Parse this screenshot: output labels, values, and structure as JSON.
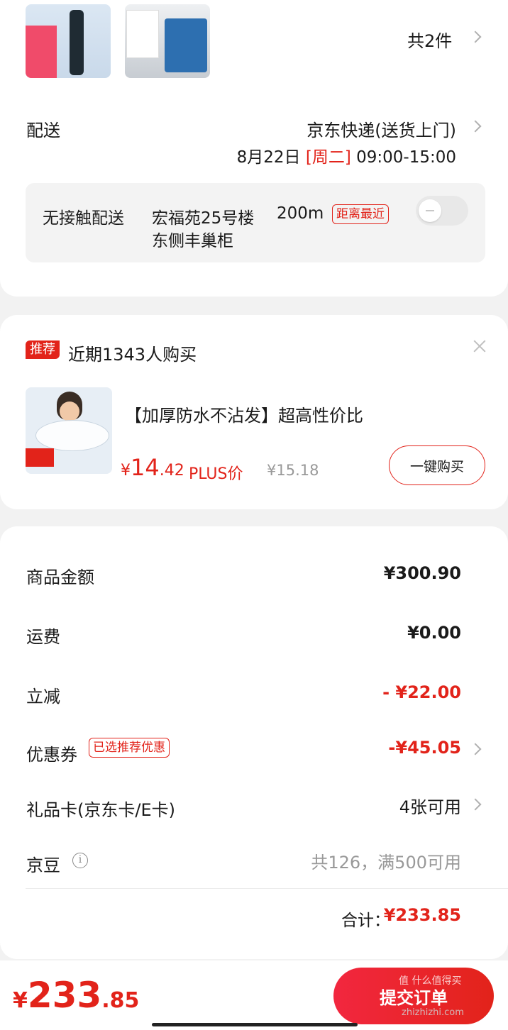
{
  "items": {
    "count_label": "共2件"
  },
  "delivery": {
    "label": "配送",
    "method": "京东快递(送货上门)",
    "date": "8月22日",
    "weekday": "[周二]",
    "time": "09:00-15:00",
    "contactless": {
      "label": "无接触配送",
      "location_line1": "宏福苑25号楼",
      "distance": "200m",
      "tag": "距离最近",
      "location_line2": "东侧丰巢柜"
    }
  },
  "recommend": {
    "badge": "推荐",
    "headline": "近期1343人购买",
    "product_title": "【加厚防水不沾发】超高性价比",
    "price_symbol": "¥",
    "price_int": "14",
    "price_dec": ".42",
    "plus_label": "PLUS价",
    "orig_price": "¥15.18",
    "buy_button": "一键购买"
  },
  "summary": {
    "rows": [
      {
        "label": "商品金额",
        "value": "¥300.90"
      },
      {
        "label": "运费",
        "value": "¥0.00"
      },
      {
        "label": "立减",
        "value": "- ¥22.00"
      },
      {
        "label": "优惠券",
        "tag": "已选推荐优惠",
        "value": "-¥45.05"
      },
      {
        "label": "礼品卡(京东卡/E卡)",
        "value": "4张可用"
      },
      {
        "label": "京豆",
        "value": "共126，满500可用"
      }
    ],
    "total_label": "合计：",
    "total_value": "¥233.85"
  },
  "footer": {
    "price_symbol": "¥",
    "price_int": "233",
    "price_dec": ".85",
    "submit_label": "提交订单",
    "watermark": "值 什么值得买",
    "watermark_url": "zhizhizhi.com"
  },
  "colors": {
    "accent": "#e2231a",
    "background": "#f2f2f2",
    "card": "#ffffff"
  }
}
